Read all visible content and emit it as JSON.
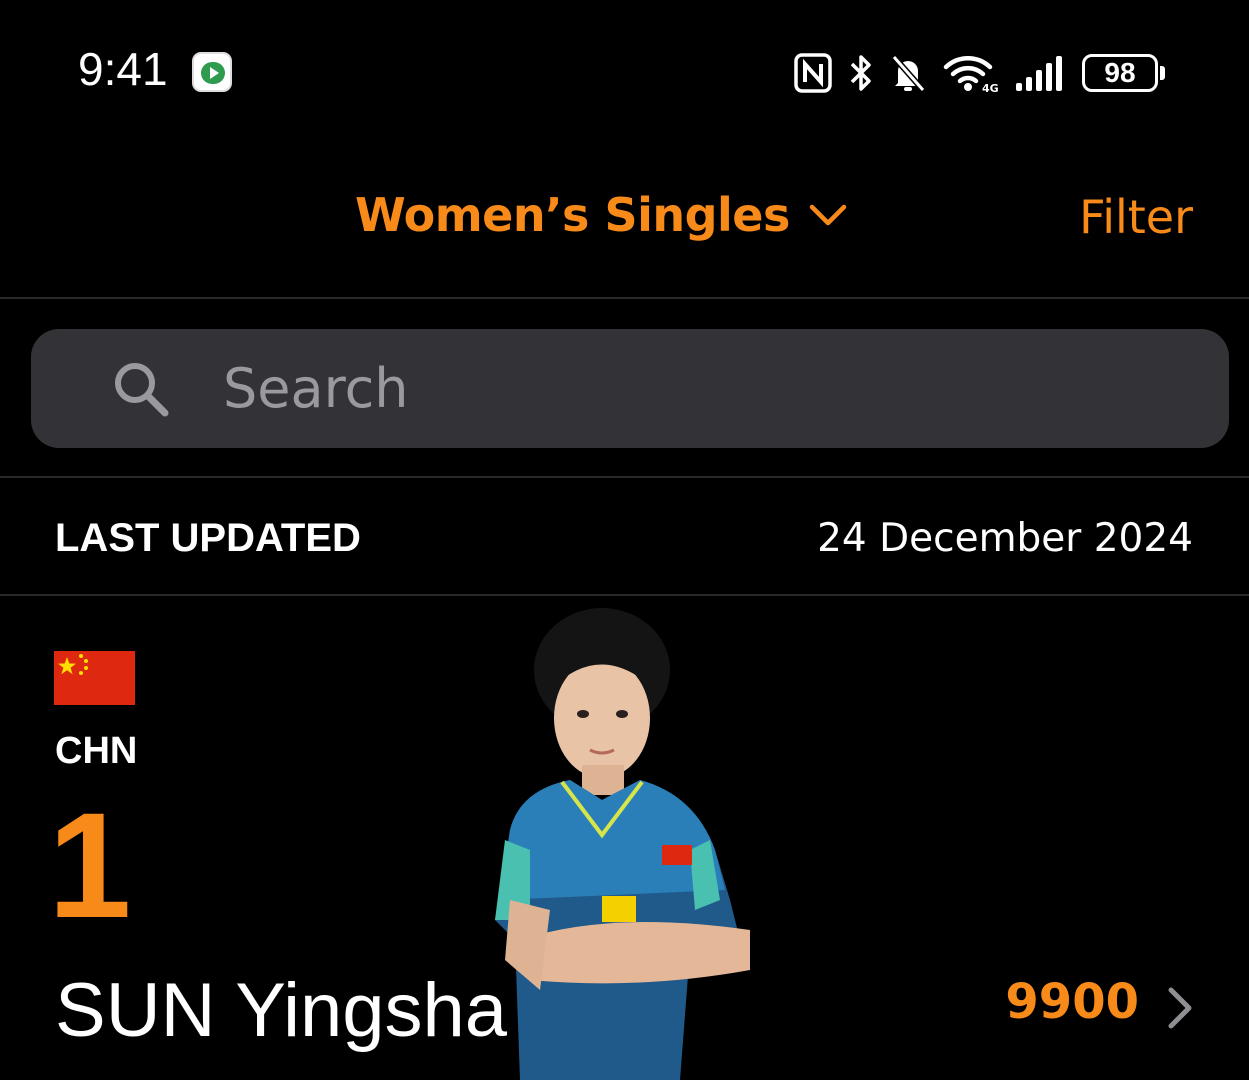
{
  "status_bar": {
    "time": "9:41",
    "app_icon": "video-app-icon",
    "icons": [
      "nfc-icon",
      "bluetooth-icon",
      "bell-muted-icon",
      "wifi-icon",
      "signal-icon",
      "battery-icon"
    ],
    "battery": "98"
  },
  "header": {
    "category": "Women’s Singles",
    "category_icon": "chevron-down-icon",
    "filter_label": "Filter"
  },
  "search": {
    "placeholder": "Search",
    "value": ""
  },
  "last_updated": {
    "label": "LAST UPDATED",
    "date": "24 December 2024"
  },
  "rankings": [
    {
      "country": "CHN",
      "flag": "china-flag",
      "rank": "1",
      "name": "SUN Yingsha",
      "points": "9900"
    }
  ],
  "colors": {
    "accent": "#f88a1a",
    "background": "#000000",
    "search_bg": "#333337",
    "divider": "#2a2a2c"
  }
}
